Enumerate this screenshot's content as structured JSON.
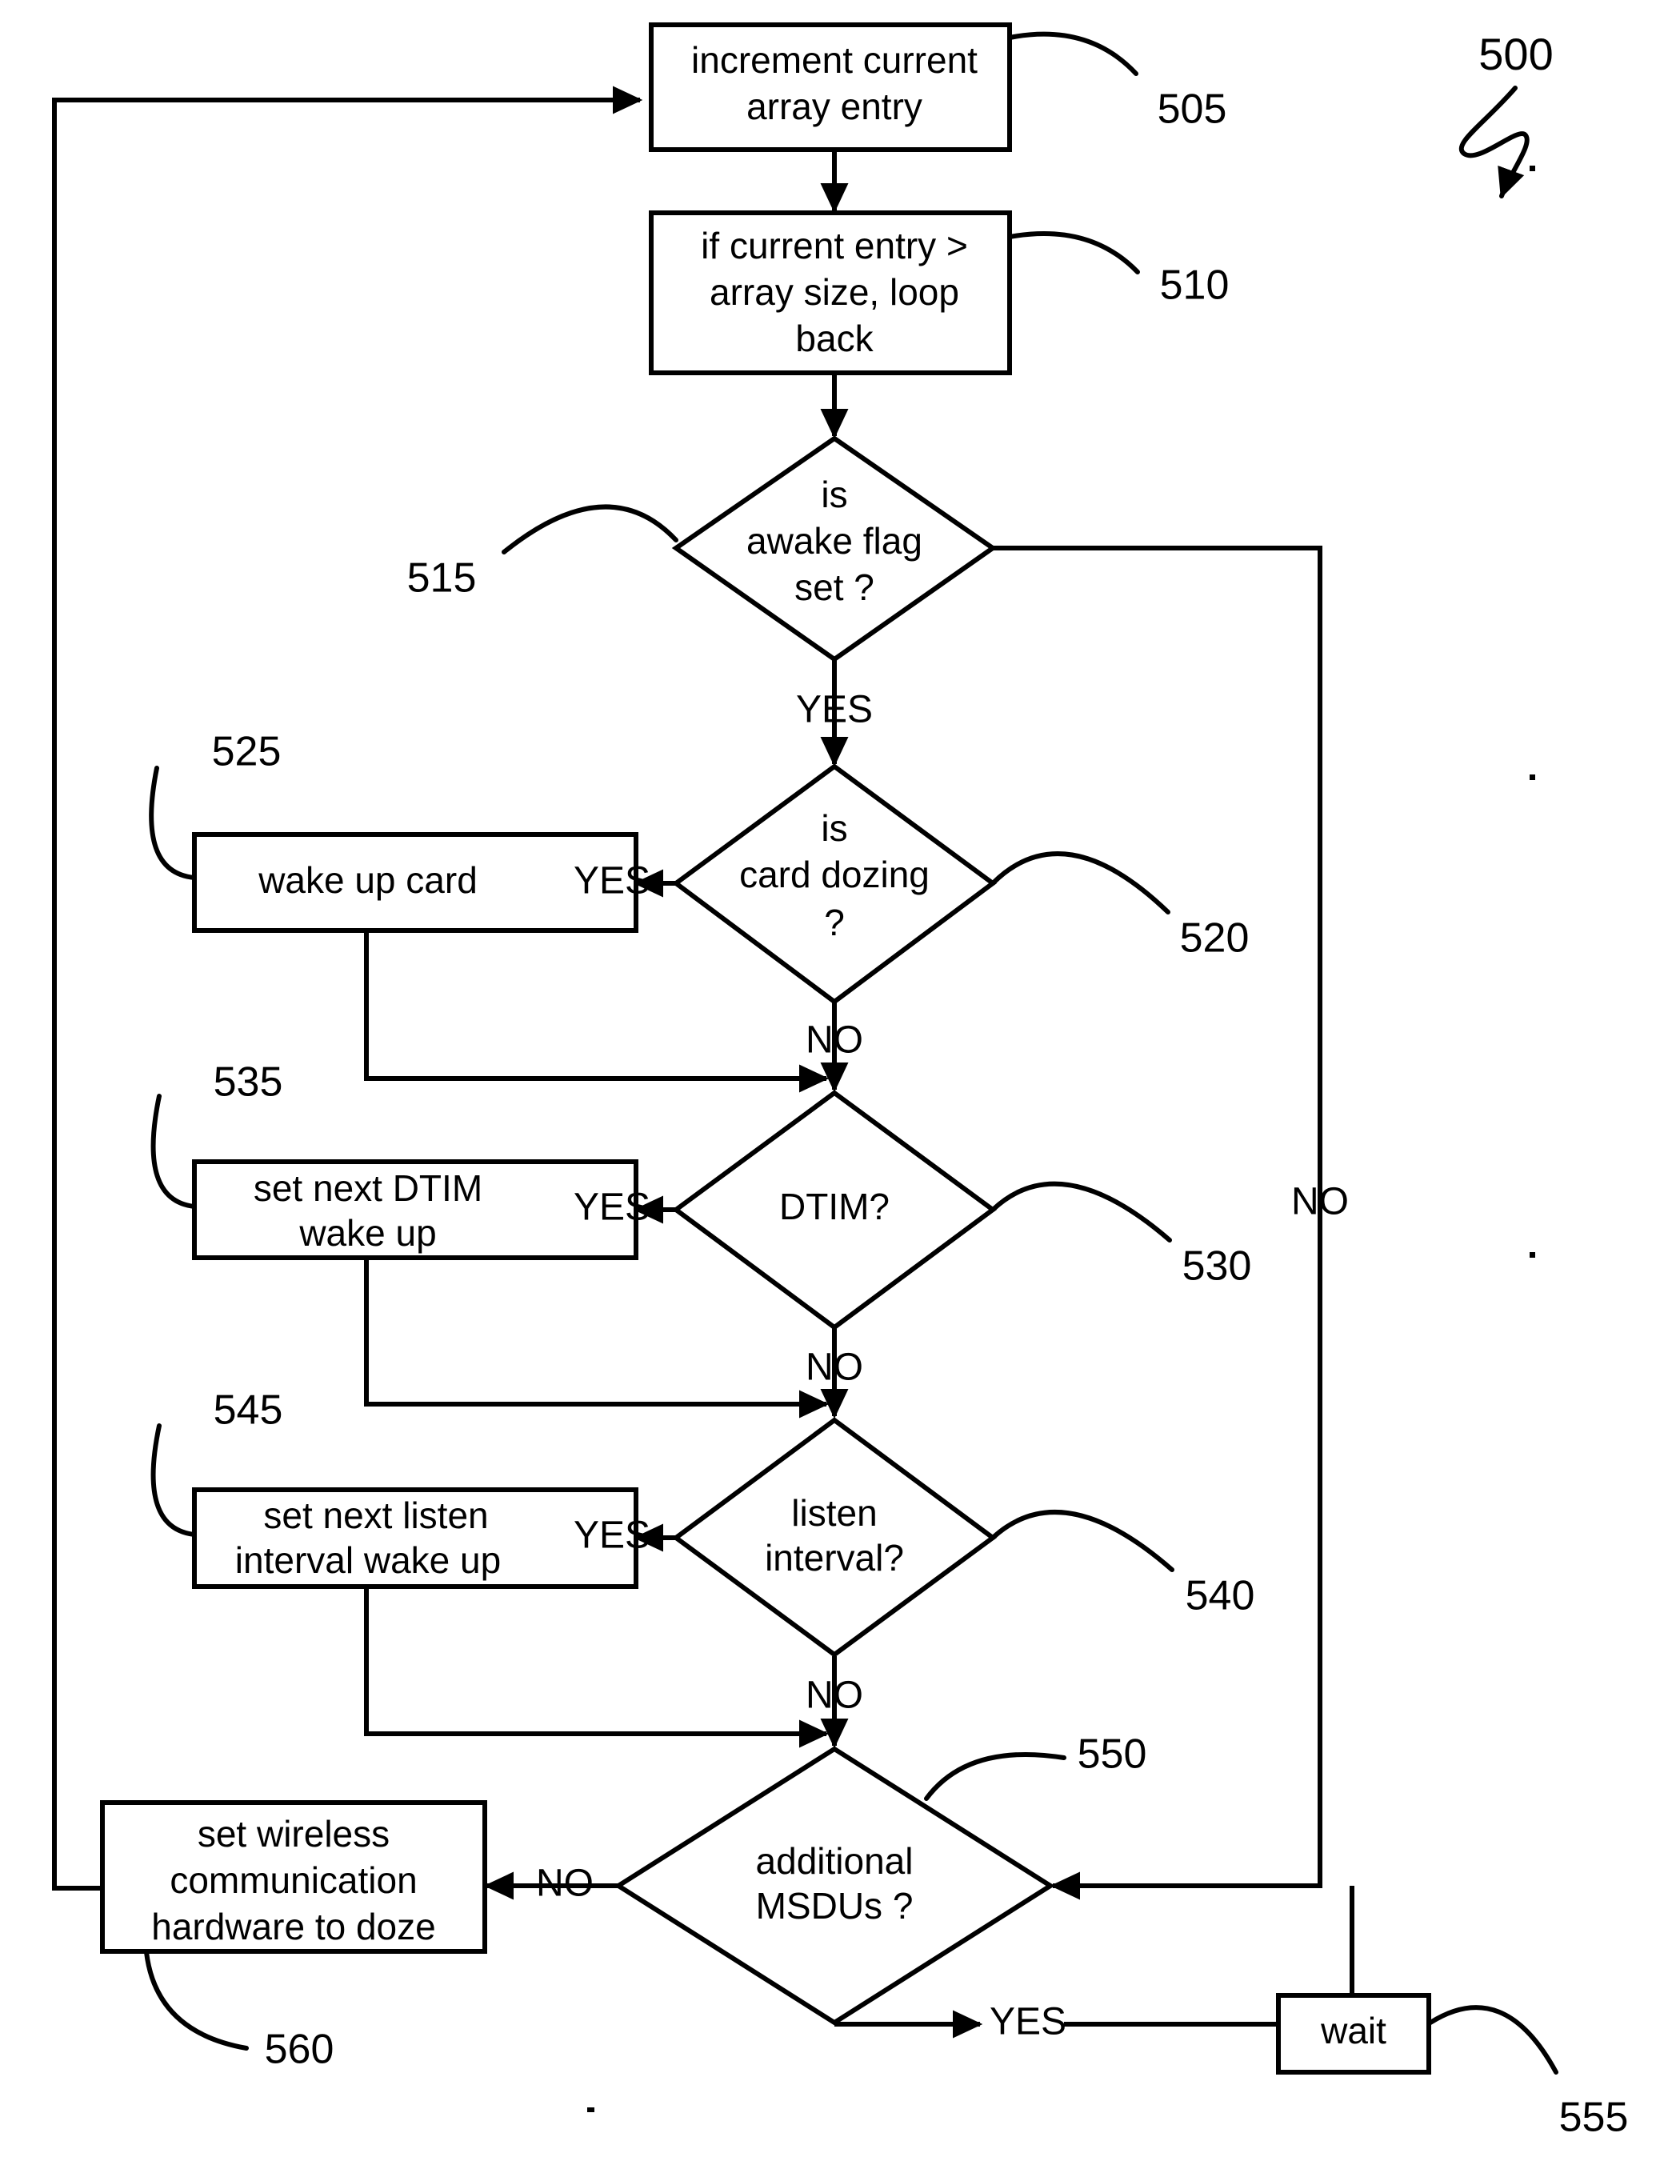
{
  "figure": {
    "number": "500",
    "kind": "flowchart"
  },
  "nodes": {
    "increment": {
      "ref": "505",
      "text_lines": [
        "increment current",
        "array entry"
      ],
      "shape": "process"
    },
    "loopback": {
      "ref": "510",
      "text_lines": [
        "if current entry >",
        "array size, loop",
        "back"
      ],
      "shape": "process"
    },
    "awake": {
      "ref": "515",
      "text_lines": [
        "is",
        "awake flag",
        "set  ?"
      ],
      "shape": "decision"
    },
    "dozing": {
      "ref": "520",
      "text_lines": [
        "is",
        "card dozing",
        "?"
      ],
      "shape": "decision"
    },
    "wakecard": {
      "ref": "525",
      "text_lines": [
        "wake up card"
      ],
      "shape": "process"
    },
    "dtim": {
      "ref": "530",
      "text_lines": [
        "DTIM?"
      ],
      "shape": "decision"
    },
    "setdtim": {
      "ref": "535",
      "text_lines": [
        "set next DTIM",
        "wake up"
      ],
      "shape": "process"
    },
    "listen": {
      "ref": "540",
      "text_lines": [
        "listen",
        "interval?"
      ],
      "shape": "decision"
    },
    "setlisten": {
      "ref": "545",
      "text_lines": [
        "set next listen",
        "interval wake up"
      ],
      "shape": "process"
    },
    "msdus": {
      "ref": "550",
      "text_lines": [
        "additional",
        "MSDUs ?"
      ],
      "shape": "decision"
    },
    "wait": {
      "ref": "555",
      "text_lines": [
        "wait"
      ],
      "shape": "process"
    },
    "doze": {
      "ref": "560",
      "text_lines": [
        "set wireless",
        "communication",
        "hardware to doze"
      ],
      "shape": "process"
    }
  },
  "edge_labels": {
    "awake_yes": "YES",
    "awake_no": "NO",
    "dozing_yes": "YES",
    "dozing_no": "NO",
    "dtim_yes": "YES",
    "dtim_no": "NO",
    "listen_yes": "YES",
    "listen_no": "NO",
    "msdus_no": "NO",
    "msdus_yes": "YES"
  },
  "colors": {
    "stroke": "#000000",
    "fill": "#ffffff",
    "background": "#ffffff"
  }
}
